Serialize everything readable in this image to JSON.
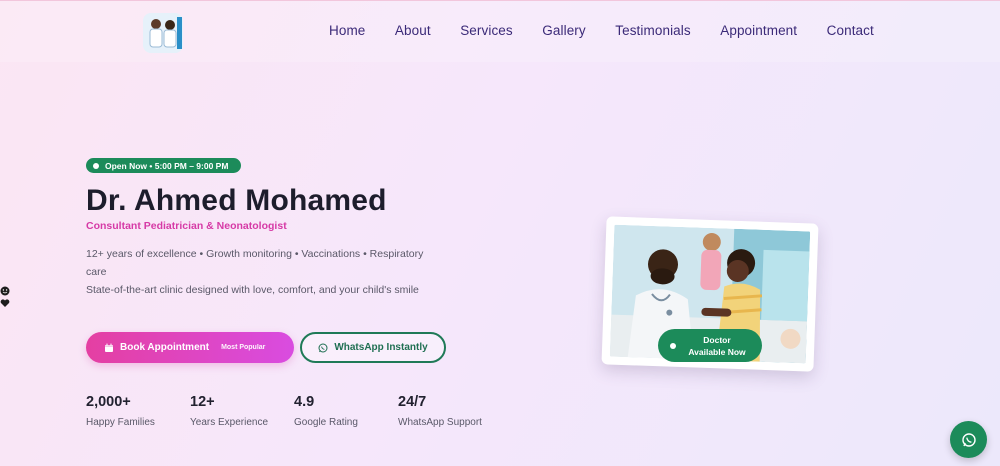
{
  "nav": {
    "items": [
      "Home",
      "About",
      "Services",
      "Gallery",
      "Testimonials",
      "Appointment",
      "Contact"
    ]
  },
  "hero": {
    "open_badge": "Open Now • 5:00 PM – 9:00 PM",
    "title": "Dr. Ahmed Mohamed",
    "subtitle": "Consultant Pediatrician & Neonatologist",
    "desc_line1": "12+ years of excellence • Growth monitoring • Vaccinations • Respiratory care",
    "desc_line2": "State-of-the-art clinic designed with love, comfort, and your child's smile",
    "book_label": "Book Appointment",
    "book_tag": "Most Popular",
    "whatsapp_label": "WhatsApp Instantly"
  },
  "stats": [
    {
      "num": "2,000+",
      "label": "Happy Families"
    },
    {
      "num": "12+",
      "label": "Years Experience"
    },
    {
      "num": "4.9",
      "label": "Google Rating"
    },
    {
      "num": "24/7",
      "label": "WhatsApp Support"
    }
  ],
  "photo": {
    "pill_line1": "Doctor",
    "pill_line2": "Available Now"
  },
  "colors": {
    "accent_pink": "#e43fa2",
    "accent_green": "#1c8b5a",
    "nav_text": "#3b2a78"
  }
}
